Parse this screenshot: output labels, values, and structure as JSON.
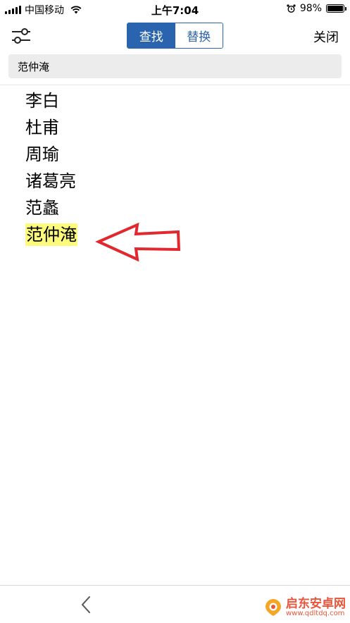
{
  "status_bar": {
    "carrier": "中国移动",
    "time": "上午7:04",
    "battery_text": "98%",
    "battery_level": 0.98,
    "icons": [
      "signal-icon",
      "wifi-icon",
      "alarm-icon",
      "battery-icon"
    ]
  },
  "toolbar": {
    "settings_icon": "sliders-icon",
    "tabs": [
      {
        "label": "查找",
        "active": true
      },
      {
        "label": "替换",
        "active": false
      }
    ],
    "close_label": "关闭",
    "accent_color": "#2a63ae"
  },
  "search": {
    "value": "范仲淹"
  },
  "document": {
    "lines": [
      "李白",
      "杜甫",
      "周瑜",
      "诸葛亮",
      "范蠡",
      "范仲淹"
    ],
    "highlighted_line_index": 5,
    "highlight_color": "#fdfb7c"
  },
  "annotation": {
    "arrow_color": "#e0282e",
    "arrow_icon": "left-arrow-icon"
  },
  "bottom_bar": {
    "back_icon": "chevron-left-icon"
  },
  "watermark": {
    "title": "启东安卓网",
    "url": "www.qdltdq.com"
  }
}
